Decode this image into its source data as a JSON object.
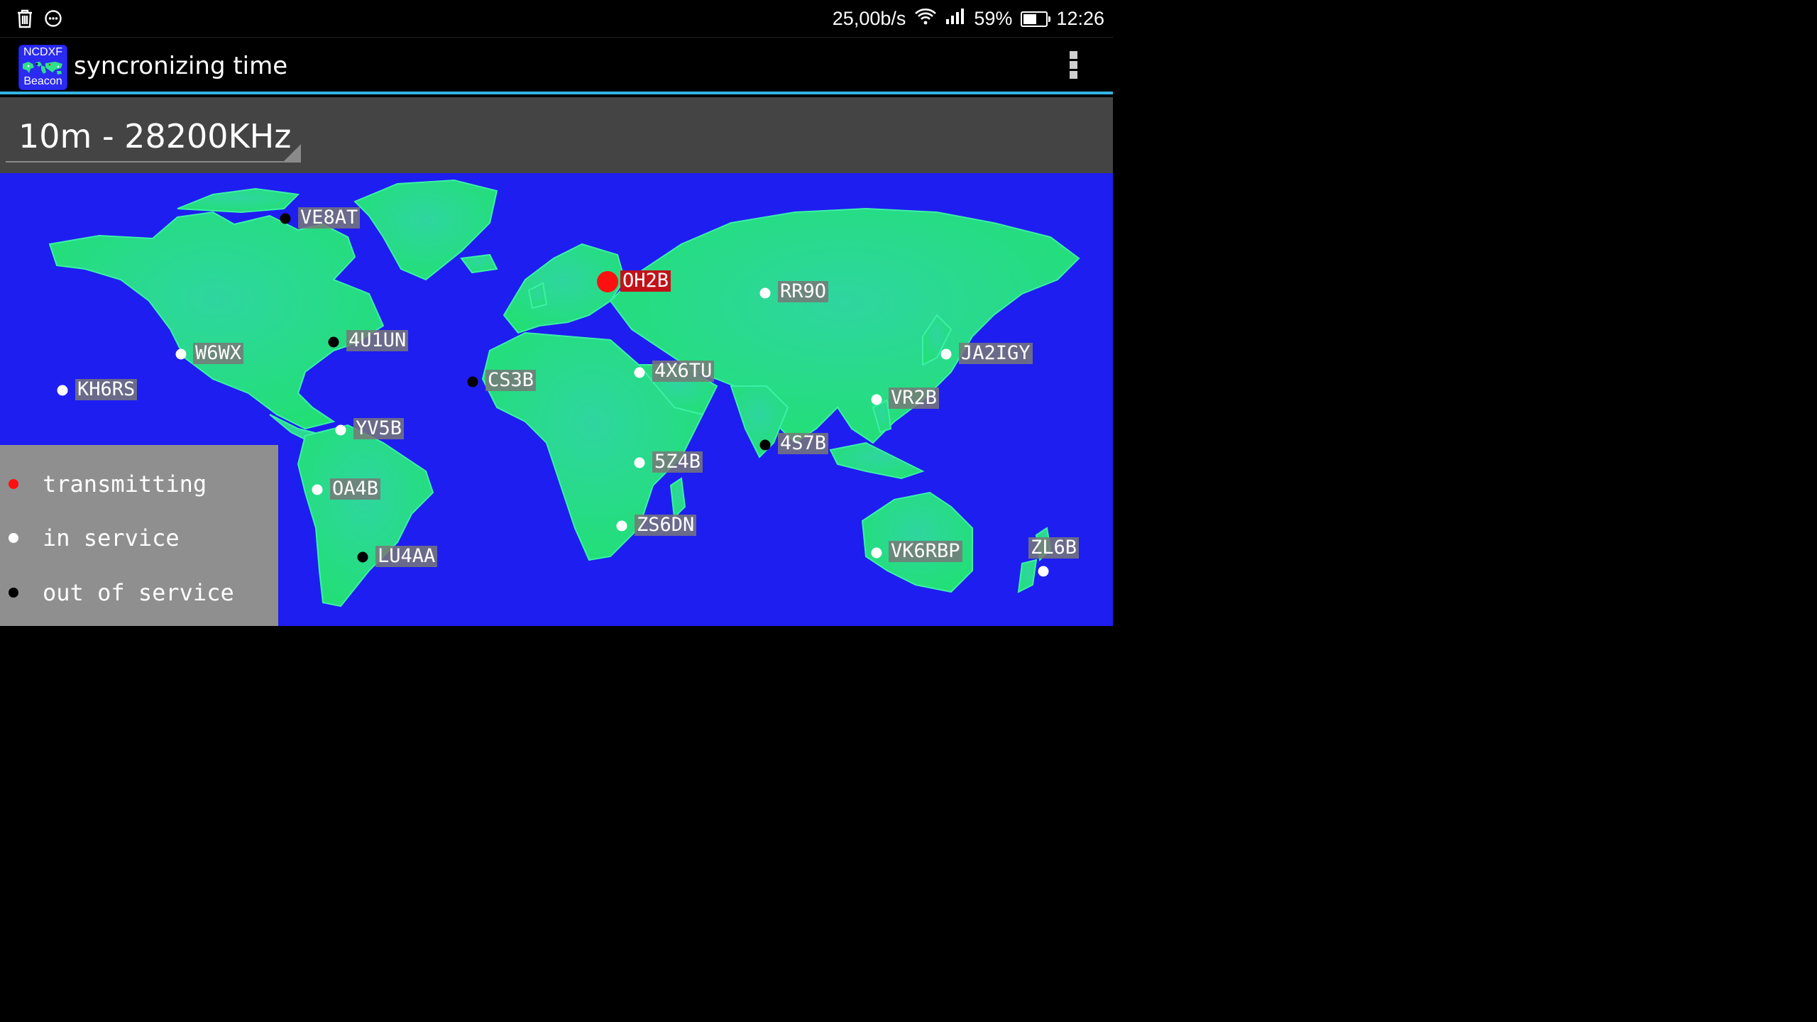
{
  "status_bar": {
    "speed": "25,00b/s",
    "battery": "59%",
    "battery_level": 0.59,
    "time": "12:26",
    "icons": [
      "trash-icon",
      "message-icon",
      "wifi-icon",
      "signal-icon",
      "battery-icon"
    ]
  },
  "app": {
    "icon_top": "NCDXF",
    "icon_bottom": "Beacon",
    "title": "syncronizing time"
  },
  "band": {
    "selected": "10m - 28200KHz"
  },
  "colors": {
    "ocean": "#1e1ef0",
    "land": "#2fe08a",
    "transmitting": "#ff1010",
    "in_service": "#ffffff",
    "out_of_service": "#000000",
    "accent": "#33b5e5"
  },
  "beacons": [
    {
      "call": "VE8AT",
      "status": "out_of_service"
    },
    {
      "call": "OH2B",
      "status": "transmitting"
    },
    {
      "call": "RR9O",
      "status": "in_service"
    },
    {
      "call": "4U1UN",
      "status": "out_of_service"
    },
    {
      "call": "W6WX",
      "status": "in_service"
    },
    {
      "call": "KH6RS",
      "status": "in_service"
    },
    {
      "call": "CS3B",
      "status": "out_of_service"
    },
    {
      "call": "4X6TU",
      "status": "in_service"
    },
    {
      "call": "JA2IGY",
      "status": "in_service"
    },
    {
      "call": "VR2B",
      "status": "in_service"
    },
    {
      "call": "YV5B",
      "status": "in_service"
    },
    {
      "call": "4S7B",
      "status": "out_of_service"
    },
    {
      "call": "5Z4B",
      "status": "in_service"
    },
    {
      "call": "OA4B",
      "status": "in_service"
    },
    {
      "call": "ZS6DN",
      "status": "in_service"
    },
    {
      "call": "LU4AA",
      "status": "out_of_service"
    },
    {
      "call": "VK6RBP",
      "status": "in_service"
    },
    {
      "call": "ZL6B",
      "status": "in_service"
    }
  ],
  "legend": [
    {
      "label": "transmitting",
      "status": "transmitting"
    },
    {
      "label": "in service",
      "status": "in_service"
    },
    {
      "label": "out of service",
      "status": "out_of_service"
    }
  ]
}
